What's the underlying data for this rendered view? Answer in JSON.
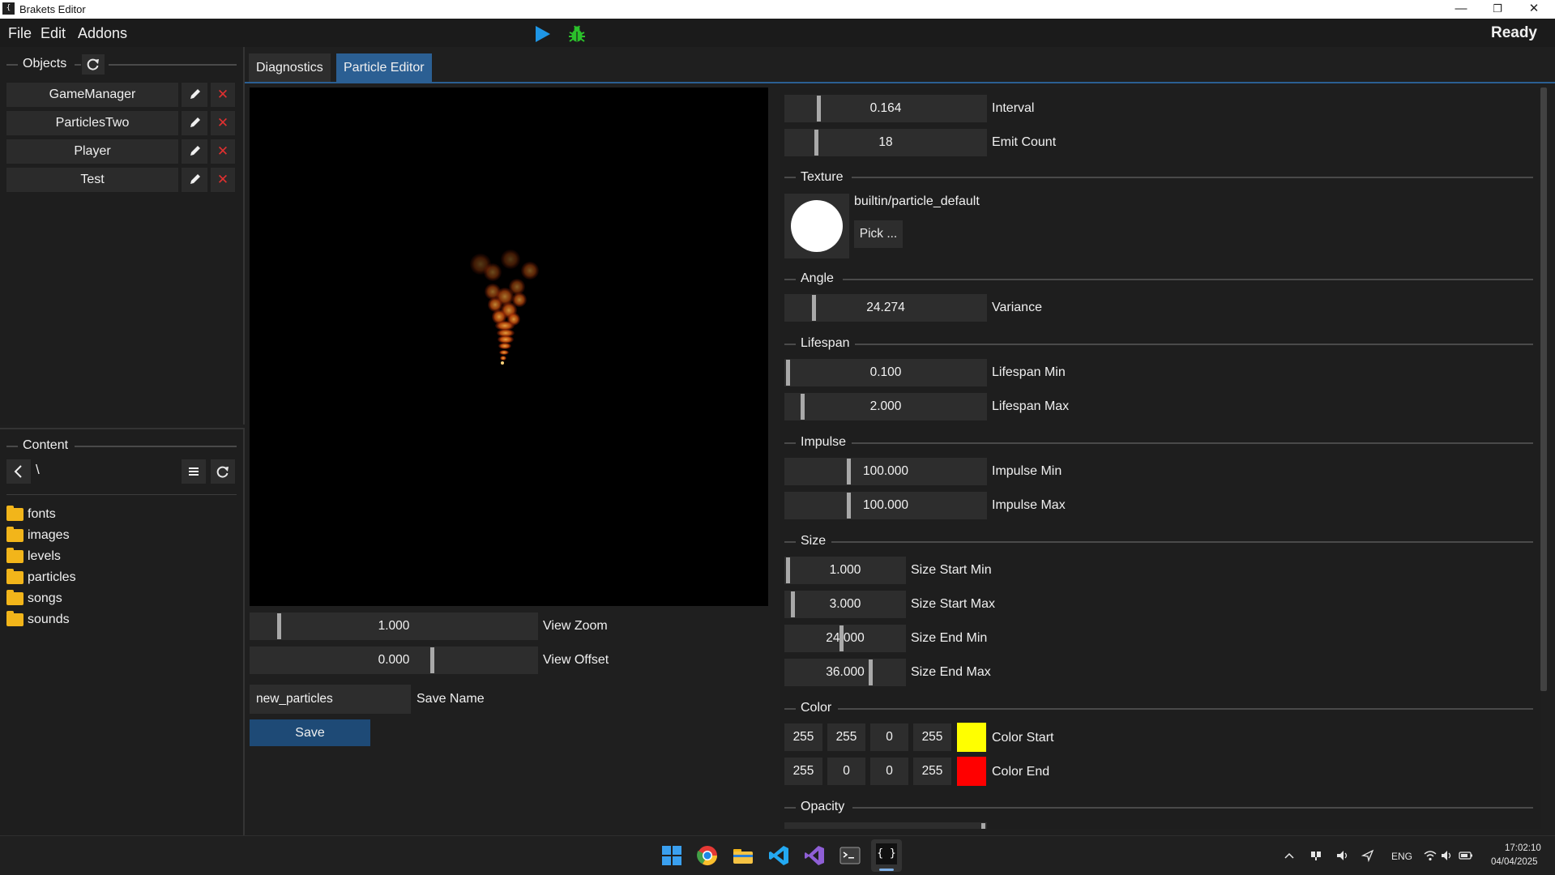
{
  "window": {
    "title": "Brakets Editor",
    "app_icon_glyph": "{ }",
    "minimize_glyph": "—",
    "restore_glyph": "❐",
    "close_glyph": "✕"
  },
  "menubar": {
    "items": [
      "File",
      "Edit",
      "Addons"
    ],
    "status": "Ready",
    "play_icon": "play-icon",
    "debug_icon": "bug-icon",
    "accent_play": "#1e96e6",
    "accent_debug": "#2bc02b"
  },
  "objects_panel": {
    "title": "Objects",
    "refresh_icon": "refresh-icon",
    "items": [
      {
        "name": "GameManager"
      },
      {
        "name": "ParticlesTwo"
      },
      {
        "name": "Player"
      },
      {
        "name": "Test"
      }
    ],
    "edit_icon": "pencil-icon",
    "delete_glyph": "✕"
  },
  "content_panel": {
    "title": "Content",
    "path": "\\",
    "back_icon": "chevron-left-icon",
    "menu_icon": "hamburger-icon",
    "refresh_icon": "refresh-icon",
    "folders": [
      "fonts",
      "images",
      "levels",
      "particles",
      "songs",
      "sounds"
    ]
  },
  "tabs": [
    {
      "label": "Diagnostics",
      "active": false
    },
    {
      "label": "Particle Editor",
      "active": true
    }
  ],
  "preview": {
    "view_zoom_value": "1.000",
    "view_zoom_label": "View Zoom",
    "view_offset_value": "0.000",
    "view_offset_label": "View Offset",
    "save_name_value": "new_particles",
    "save_name_label": "Save Name",
    "save_button": "Save"
  },
  "properties": {
    "interval": {
      "value": "0.164",
      "label": "Interval"
    },
    "emit_count": {
      "value": "18",
      "label": "Emit Count"
    },
    "texture": {
      "section": "Texture",
      "path": "builtin/particle_default",
      "pick_button": "Pick ..."
    },
    "angle": {
      "section": "Angle",
      "variance": {
        "value": "24.274",
        "label": "Variance"
      }
    },
    "lifespan": {
      "section": "Lifespan",
      "min": {
        "value": "0.100",
        "label": "Lifespan Min"
      },
      "max": {
        "value": "2.000",
        "label": "Lifespan Max"
      }
    },
    "impulse": {
      "section": "Impulse",
      "min": {
        "value": "100.000",
        "label": "Impulse Min"
      },
      "max": {
        "value": "100.000",
        "label": "Impulse Max"
      }
    },
    "size": {
      "section": "Size",
      "start_min": {
        "value": "1.000",
        "label": "Size Start Min"
      },
      "start_max": {
        "value": "3.000",
        "label": "Size Start Max"
      },
      "end_min": {
        "value": "24.000",
        "label": "Size End Min"
      },
      "end_max": {
        "value": "36.000",
        "label": "Size End Max"
      }
    },
    "color": {
      "section": "Color",
      "start": {
        "r": "255",
        "g": "255",
        "b": "0",
        "a": "255",
        "label": "Color Start",
        "swatch": "#ffff00"
      },
      "end": {
        "r": "255",
        "g": "0",
        "b": "0",
        "a": "255",
        "label": "Color End",
        "swatch": "#ff0000"
      }
    },
    "opacity": {
      "section": "Opacity"
    }
  },
  "taskbar": {
    "pinned_icons": [
      "windows-start-icon",
      "chrome-icon",
      "file-explorer-icon",
      "vscode-icon",
      "visual-studio-icon",
      "terminal-icon",
      "brakets-editor-icon"
    ],
    "tray": {
      "language": "ENG",
      "time": "17:02:10",
      "date": "04/04/2025"
    }
  }
}
